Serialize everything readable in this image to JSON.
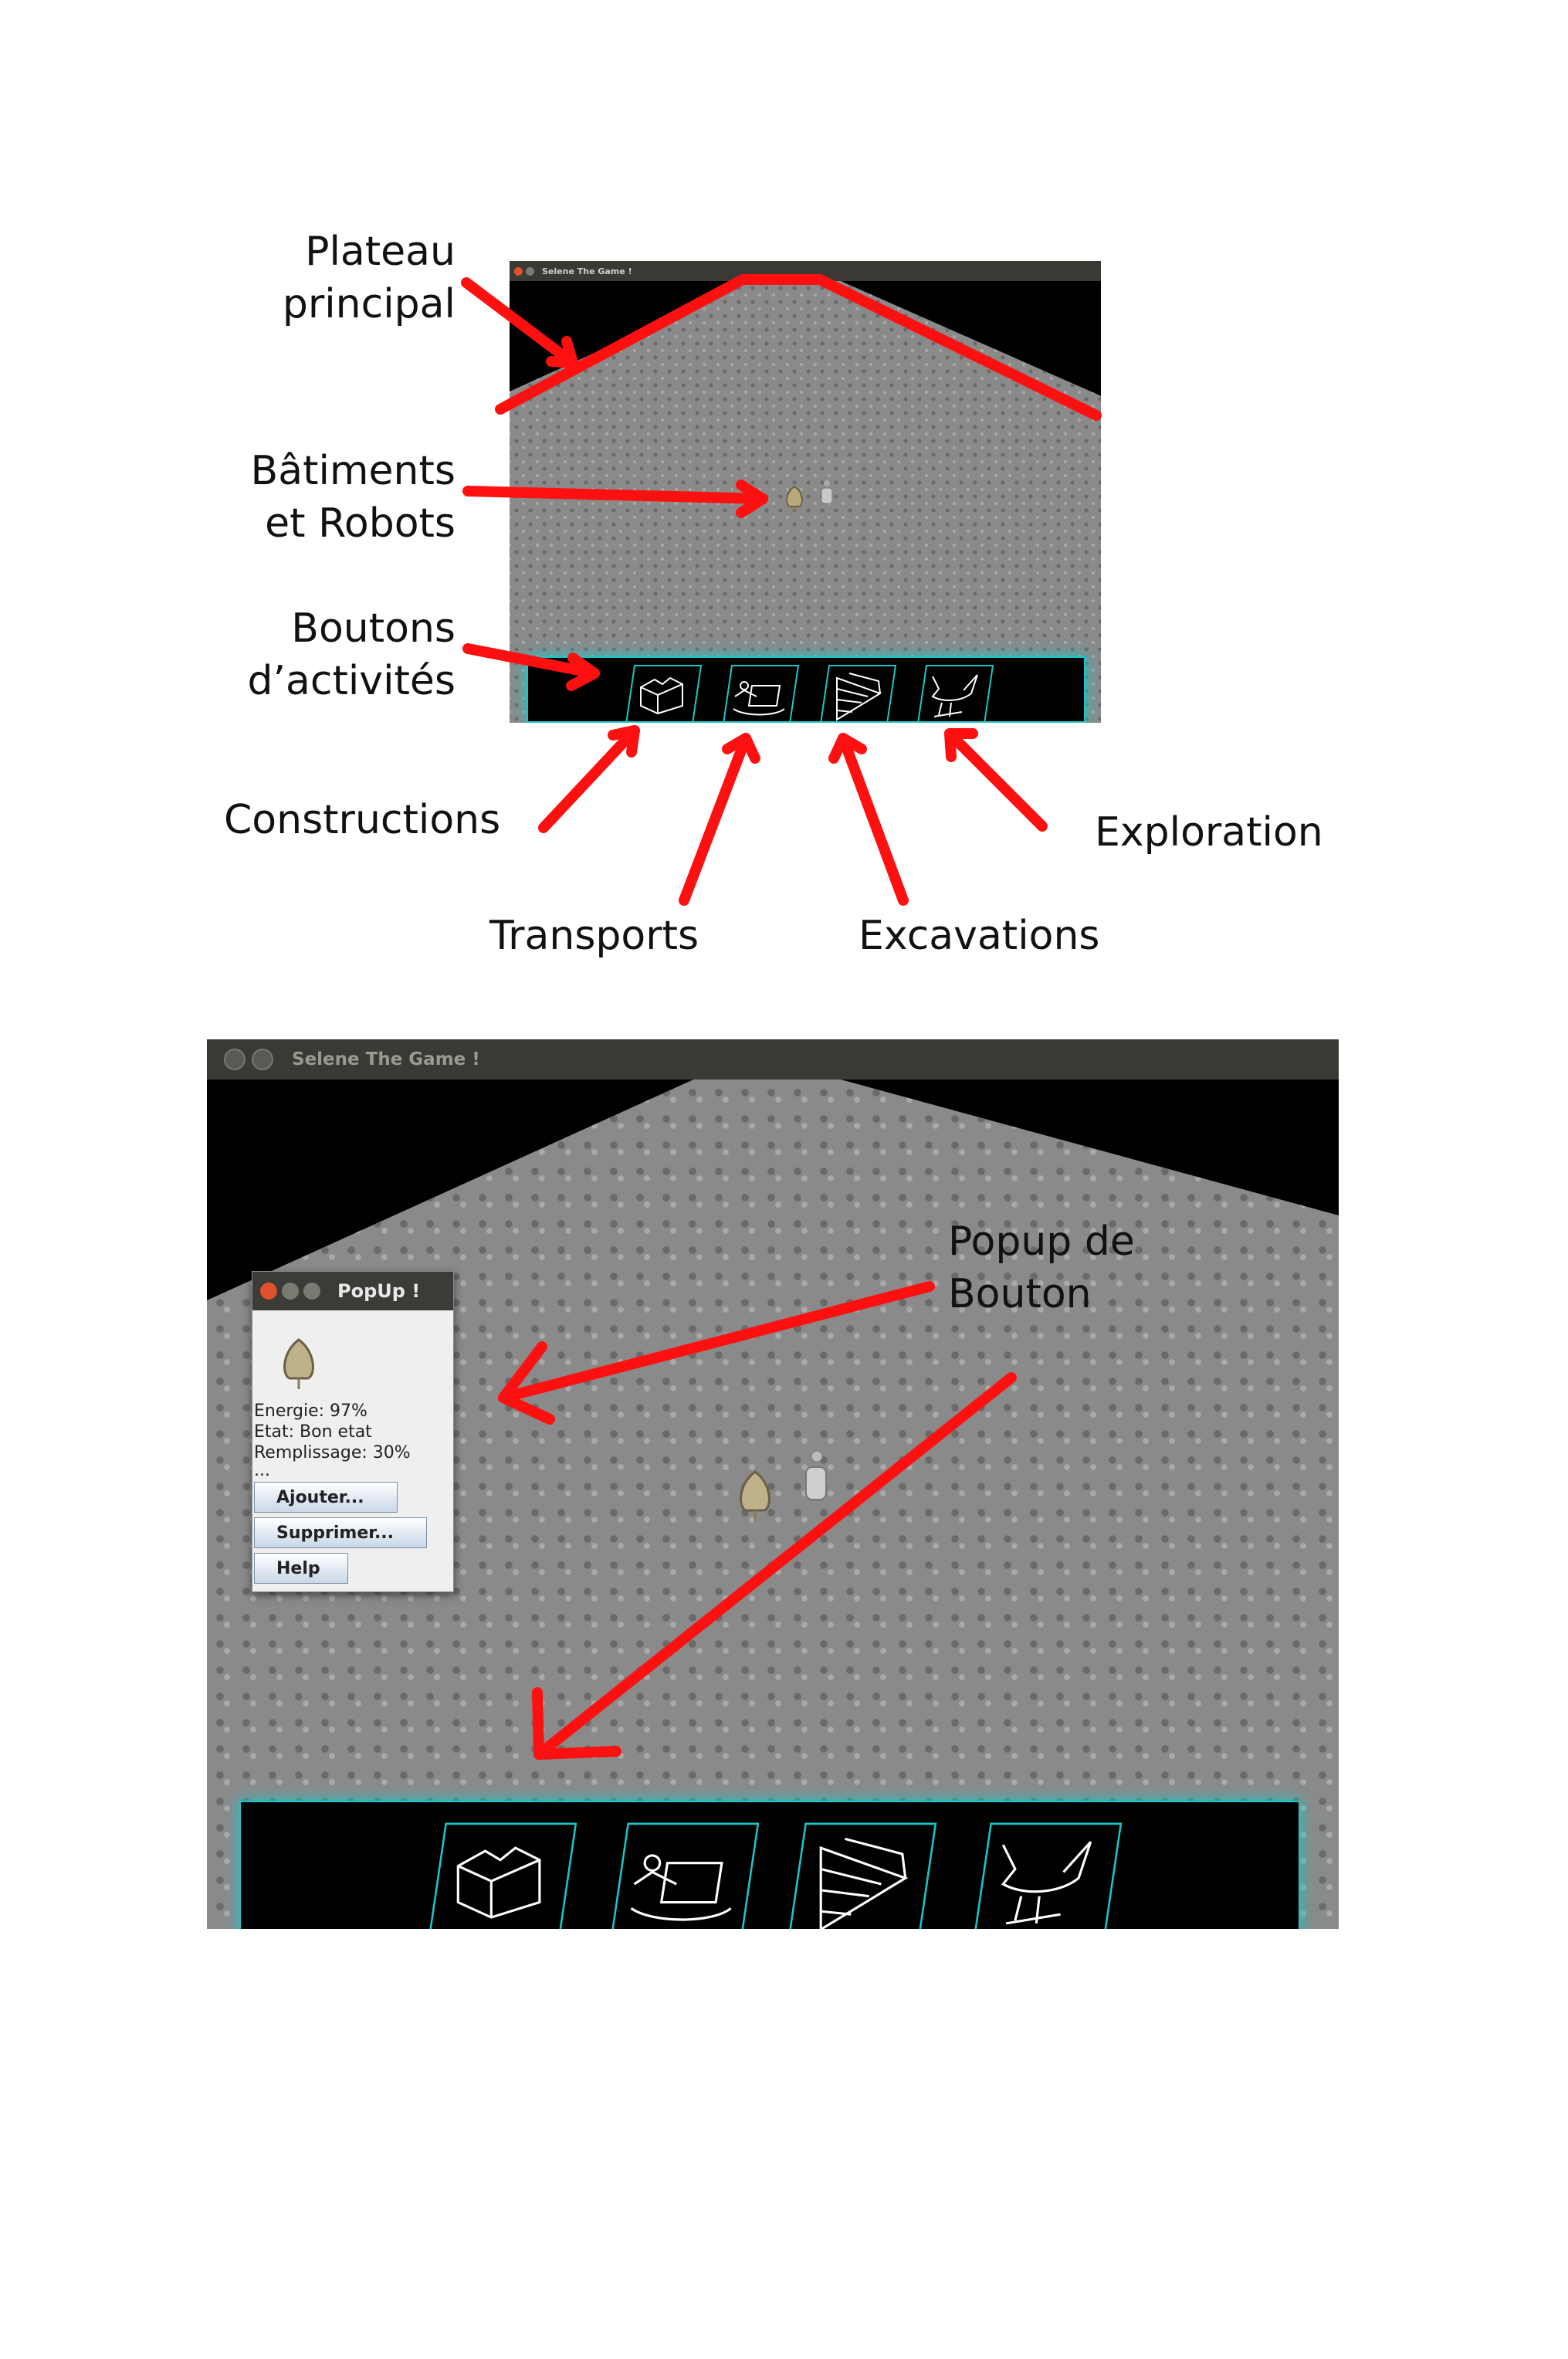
{
  "window_title": "Selene The Game !",
  "labels": {
    "plateau": "Plateau\nprincipal",
    "batiments": "Bâtiments\net Robots",
    "boutons": "Boutons\nd’activités",
    "constructions": "Constructions",
    "transports": "Transports",
    "excavations": "Excavations",
    "exploration": "Exploration",
    "popup_bouton": "Popup de\n   Bouton"
  },
  "popup": {
    "title": "PopUp !",
    "energie": "Energie: 97%",
    "etat": "Etat: Bon etat",
    "remplissage": "Remplissage: 30%",
    "ellipsis": "...",
    "btn_ajouter": "Ajouter...",
    "btn_supprimer": "Supprimer...",
    "btn_help": "Help"
  },
  "activities": [
    {
      "name": "constructions",
      "icon": "factory-icon"
    },
    {
      "name": "transports",
      "icon": "boat-icon"
    },
    {
      "name": "excavations",
      "icon": "layers-icon"
    },
    {
      "name": "exploration",
      "icon": "bird-icon"
    }
  ],
  "colors": {
    "annotation": "#ff1010",
    "tray_glow": "#18c7c9",
    "titlebar": "#3a3934"
  }
}
